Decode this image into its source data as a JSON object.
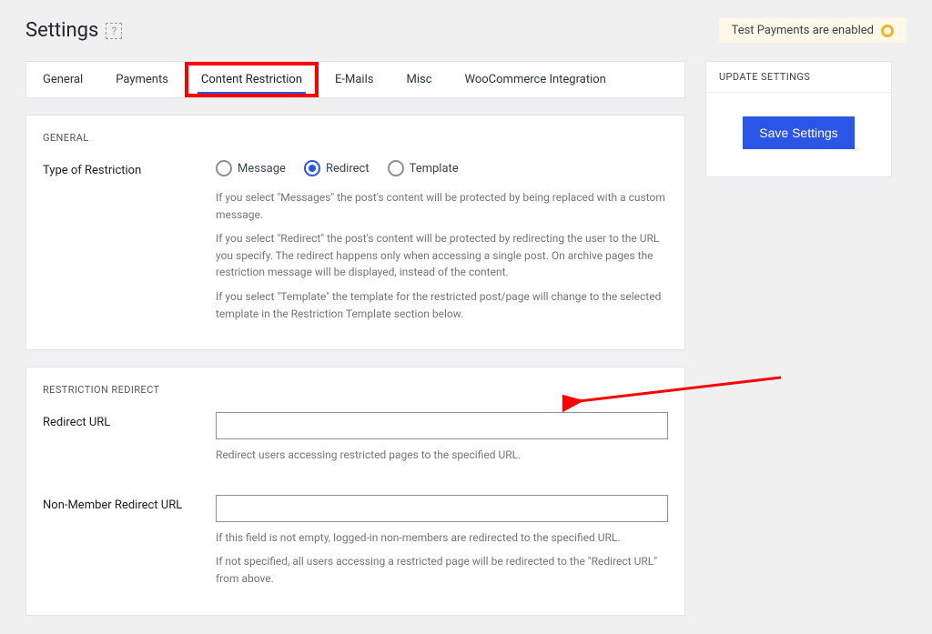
{
  "header": {
    "title": "Settings",
    "help_tooltip": "?",
    "notice": "Test Payments are enabled"
  },
  "tabs": {
    "items": [
      {
        "label": "General"
      },
      {
        "label": "Payments"
      },
      {
        "label": "Content Restriction",
        "active": true
      },
      {
        "label": "E-Mails"
      },
      {
        "label": "Misc"
      },
      {
        "label": "WooCommerce Integration"
      }
    ]
  },
  "general_card": {
    "heading": "GENERAL",
    "restriction_label": "Type of Restriction",
    "options": {
      "message": "Message",
      "redirect": "Redirect",
      "template": "Template"
    },
    "desc1": "If you select \"Messages\" the post's content will be protected by being replaced with a custom message.",
    "desc2": "If you select \"Redirect\" the post's content will be protected by redirecting the user to the URL you specify. The redirect happens only when accessing a single post. On archive pages the restriction message will be displayed, instead of the content.",
    "desc3": "If you select \"Template\" the template for the restricted post/page will change to the selected template in the Restriction Template section below."
  },
  "redirect_card": {
    "heading": "RESTRICTION REDIRECT",
    "url_label": "Redirect URL",
    "url_value": "",
    "url_desc": "Redirect users accessing restricted pages to the specified URL.",
    "nonmember_label": "Non-Member Redirect URL",
    "nonmember_value": "",
    "nonmember_desc1": "If this field is not empty, logged-in non-members are redirected to the specified URL.",
    "nonmember_desc2": "If not specified, all users accessing a restricted page will be redirected to the \"Redirect URL\" from above."
  },
  "sidebar": {
    "heading": "UPDATE SETTINGS",
    "save_label": "Save Settings"
  }
}
